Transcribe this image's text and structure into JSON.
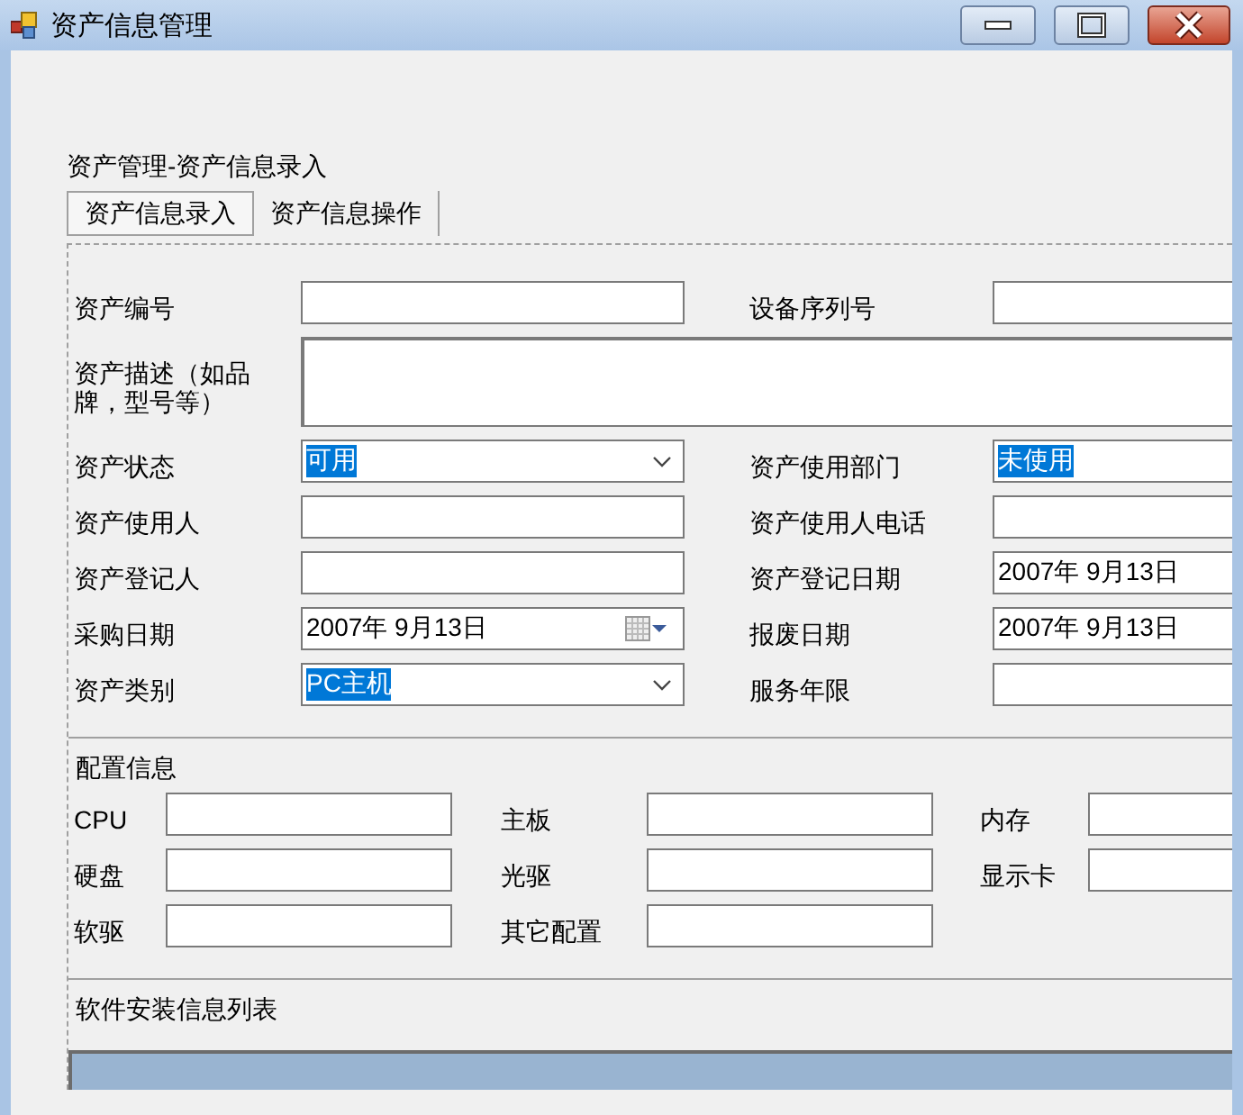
{
  "window": {
    "title": "资产信息管理"
  },
  "header": "资产管理-资产信息录入",
  "tabs": [
    {
      "label": "资产信息录入",
      "selected": true
    },
    {
      "label": "资产信息操作",
      "selected": false
    }
  ],
  "fields": [
    {
      "label": "资产编号",
      "kind": "text"
    },
    {
      "label": "设备序列号",
      "kind": "text"
    },
    {
      "label": "资产描述（如品牌，型号等）",
      "kind": "textarea"
    },
    {
      "label": "资产状态",
      "kind": "combo",
      "value": "可用",
      "highlighted": true
    },
    {
      "label": "资产使用部门",
      "kind": "text",
      "value": "未使用",
      "highlighted": true
    },
    {
      "label": "资产使用人",
      "kind": "text"
    },
    {
      "label": "资产使用人电话",
      "kind": "text"
    },
    {
      "label": "资产登记人",
      "kind": "text"
    },
    {
      "label": "资产登记日期",
      "kind": "date",
      "value": "2007年 9月13日"
    },
    {
      "label": "采购日期",
      "kind": "date",
      "value": "2007年 9月13日"
    },
    {
      "label": "报废日期",
      "kind": "date",
      "value": "2007年 9月13日"
    },
    {
      "label": "资产类别",
      "kind": "combo",
      "value": "PC主机",
      "highlighted": true
    },
    {
      "label": "服务年限",
      "kind": "text"
    }
  ],
  "config": {
    "title": "配置信息",
    "fields": [
      {
        "label": "CPU"
      },
      {
        "label": "主板"
      },
      {
        "label": "内存"
      },
      {
        "label": "硬盘"
      },
      {
        "label": "光驱"
      },
      {
        "label": "显示卡"
      },
      {
        "label": "软驱"
      },
      {
        "label": "其它配置"
      }
    ]
  },
  "software": {
    "title": "软件安装信息列表"
  }
}
